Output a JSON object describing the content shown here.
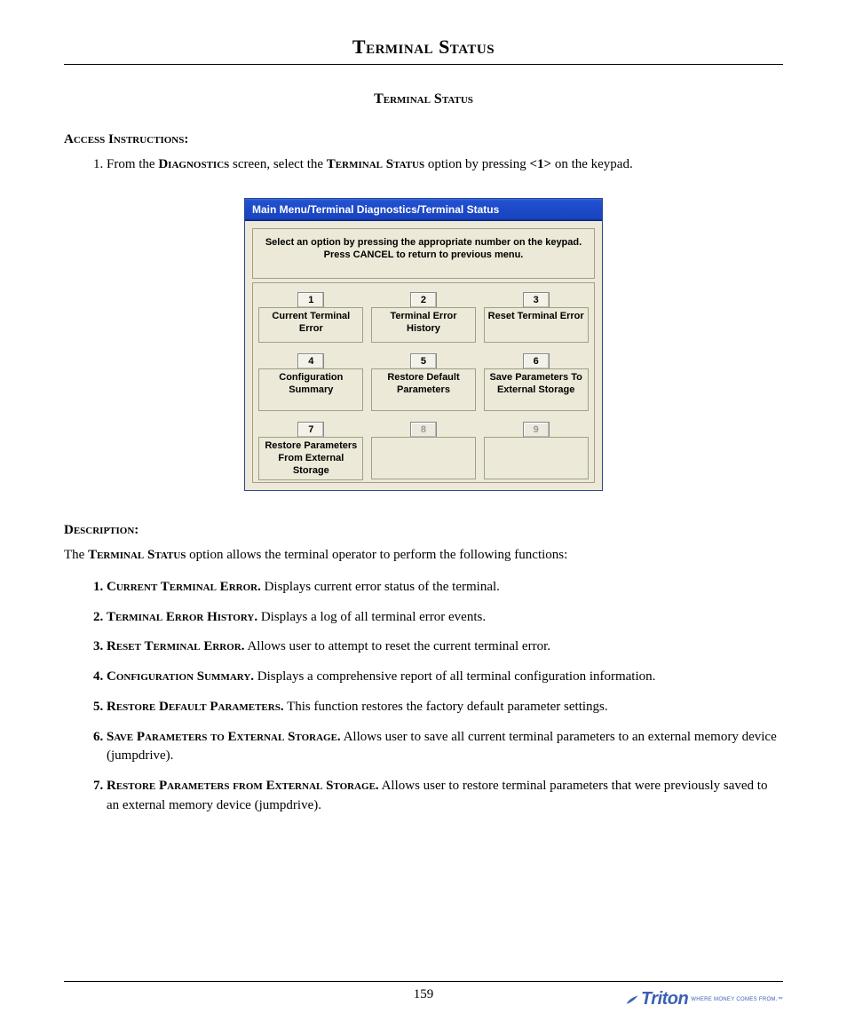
{
  "header": {
    "title": "Terminal Status"
  },
  "section_title": "Terminal Status",
  "access": {
    "label": "Access Instructions:",
    "step_prefix": "From the ",
    "step_screen": "Diagnostics",
    "step_mid": " screen, select the ",
    "step_option": "Terminal Status",
    "step_tail": " option by pressing ",
    "step_key": "<1>",
    "step_end": " on the keypad."
  },
  "dialog": {
    "titlebar": "Main Menu/Terminal Diagnostics/Terminal Status",
    "instruction_line1": "Select an option by pressing the appropriate number on the keypad.",
    "instruction_line2": "Press CANCEL to return to previous menu.",
    "options": [
      {
        "key": "1",
        "label": "Current Terminal Error",
        "enabled": true
      },
      {
        "key": "2",
        "label": "Terminal Error History",
        "enabled": true
      },
      {
        "key": "3",
        "label": "Reset Terminal Error",
        "enabled": true
      },
      {
        "key": "4",
        "label": "Configuration Summary",
        "enabled": true
      },
      {
        "key": "5",
        "label": "Restore Default Parameters",
        "enabled": true
      },
      {
        "key": "6",
        "label": "Save Parameters To External Storage",
        "enabled": true
      },
      {
        "key": "7",
        "label": "Restore Parameters From External Storage",
        "enabled": true
      },
      {
        "key": "8",
        "label": "",
        "enabled": false
      },
      {
        "key": "9",
        "label": "",
        "enabled": false
      }
    ]
  },
  "description": {
    "label": "Description:",
    "intro_pre": "The ",
    "intro_strong": "Terminal Status",
    "intro_post": " option allows the terminal operator to perform the following functions:",
    "functions": [
      {
        "name": "Current Terminal Error.",
        "text": "  Displays current error status of the terminal."
      },
      {
        "name": "Terminal Error History.",
        "text": "  Displays a log of all terminal error events."
      },
      {
        "name": "Reset Terminal Error.",
        "text": "  Allows user to attempt to reset the current terminal error."
      },
      {
        "name": "Configuration Summary.",
        "text": "  Displays a comprehensive report of all terminal configuration information."
      },
      {
        "name": "Restore Default Parameters.",
        "text": "  This function restores the factory default parameter settings."
      },
      {
        "name": "Save Parameters to External Storage.",
        "text": "  Allows user to save all current terminal parameters to an external memory device (jumpdrive)."
      },
      {
        "name": "Restore Parameters from External Storage.",
        "text": "  Allows user to restore terminal parameters that were previously saved to an external memory device (jumpdrive)."
      }
    ]
  },
  "footer": {
    "page_number": "159",
    "brand": "Triton",
    "brand_tag": "WHERE MONEY COMES FROM.™"
  }
}
